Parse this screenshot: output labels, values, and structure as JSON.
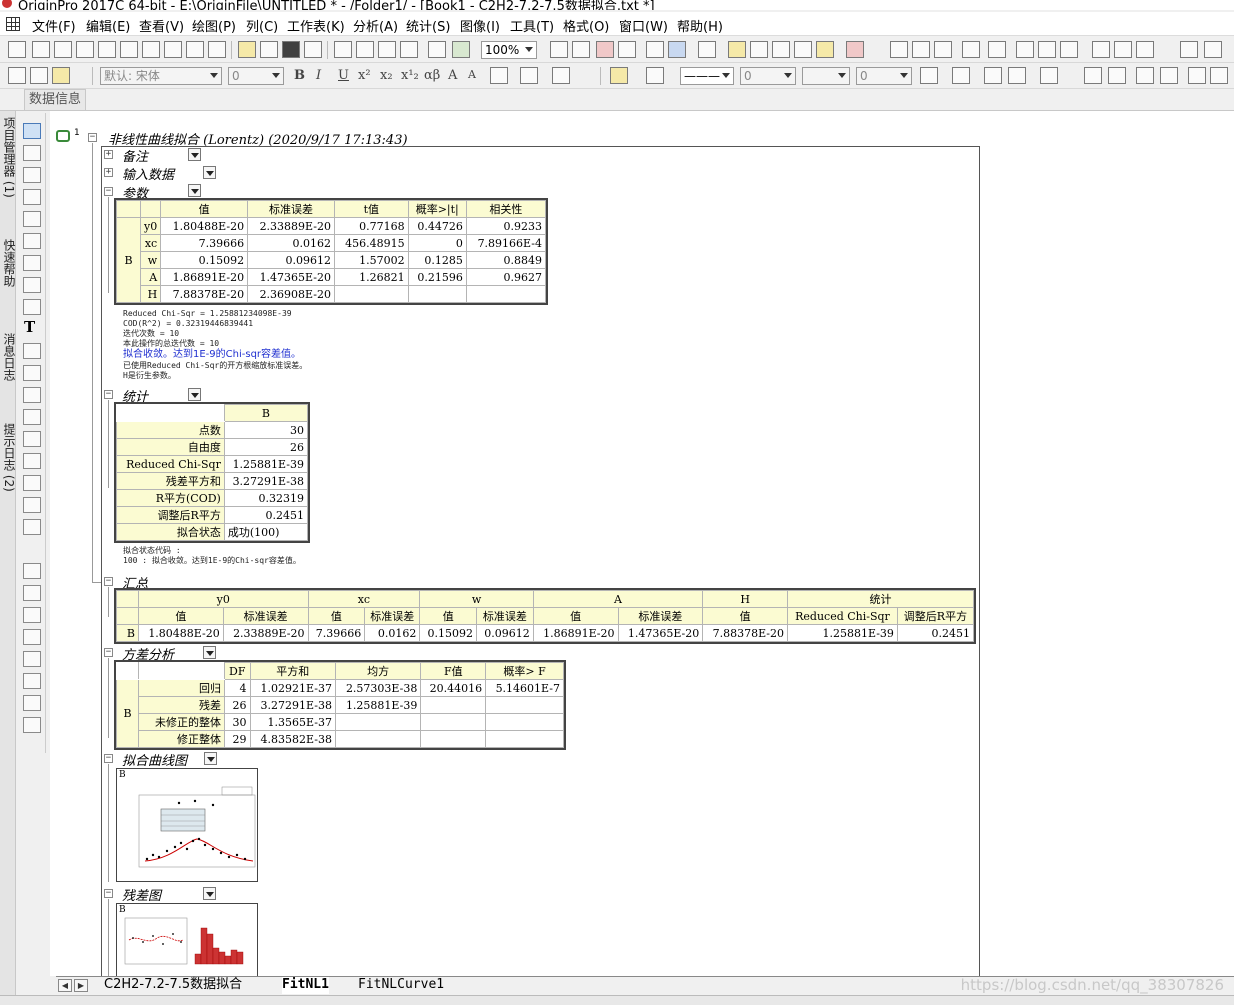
{
  "window": {
    "title": "OriginPro 2017C 64-bit - E:\\OriginFile\\UNTITLED * - /Folder1/ - [Book1 - C2H2-7.2-7.5数据拟合.txt *]"
  },
  "menu": [
    "文件(F)",
    "编辑(E)",
    "查看(V)",
    "绘图(P)",
    "列(C)",
    "工作表(K)",
    "分析(A)",
    "统计(S)",
    "图像(I)",
    "工具(T)",
    "格式(O)",
    "窗口(W)",
    "帮助(H)"
  ],
  "toolbar": {
    "zoom": "100%",
    "font": "默认: 宋体",
    "font_size": "0",
    "line_width": "0",
    "line_width2": "0",
    "styles": [
      "B",
      "I",
      "U",
      "x²",
      "x₂",
      "x¹₂",
      "αβ",
      "A",
      "A"
    ]
  },
  "data_info_tab": "数据信息",
  "left_dock_tabs": [
    "项目管理器 (1)",
    "快速帮助",
    "消息日志",
    "提示日志 (2)"
  ],
  "report": {
    "title": "非线性曲线拟合 (Lorentz) (2020/9/17 17:13:43)",
    "sections": {
      "notes": "备注",
      "input": "输入数据",
      "params": "参数",
      "stats": "统计",
      "summary": "汇总",
      "anova": "方差分析",
      "fitcurve": "拟合曲线图",
      "residual": "残差图"
    },
    "params_table": {
      "headers": [
        "值",
        "标准误差",
        "t值",
        "概率>|t|",
        "相关性"
      ],
      "group": "B",
      "rows": [
        {
          "name": "y0",
          "vals": [
            "1.80488E-20",
            "2.33889E-20",
            "0.77168",
            "0.44726",
            "0.9233"
          ]
        },
        {
          "name": "xc",
          "vals": [
            "7.39666",
            "0.0162",
            "456.48915",
            "0",
            "7.89166E-4"
          ]
        },
        {
          "name": "w",
          "vals": [
            "0.15092",
            "0.09612",
            "1.57002",
            "0.1285",
            "0.8849"
          ]
        },
        {
          "name": "A",
          "vals": [
            "1.86891E-20",
            "1.47365E-20",
            "1.26821",
            "0.21596",
            "0.9627"
          ]
        },
        {
          "name": "H",
          "vals": [
            "7.88378E-20",
            "2.36908E-20",
            "",
            "",
            ""
          ]
        }
      ]
    },
    "params_notes": [
      "Reduced Chi-Sqr = 1.25881234098E-39",
      "COD(R^2) = 0.32319446839441",
      "迭代次数 = 10",
      "本此操作的总迭代数 = 10",
      "拟合收敛。达到1E-9的Chi-sqr容差值。",
      "已使用Reduced Chi-Sqr的开方根缩放标准误差。",
      "H是衍生参数。"
    ],
    "stats_table": {
      "col": "B",
      "rows": [
        {
          "label": "点数",
          "value": "30"
        },
        {
          "label": "自由度",
          "value": "26"
        },
        {
          "label": "Reduced Chi-Sqr",
          "value": "1.25881E-39"
        },
        {
          "label": "残差平方和",
          "value": "3.27291E-38"
        },
        {
          "label": "R平方(COD)",
          "value": "0.32319"
        },
        {
          "label": "调整后R平方",
          "value": "0.2451"
        },
        {
          "label": "拟合状态",
          "value": "成功(100)"
        }
      ]
    },
    "stats_notes": [
      "拟合状态代码 :",
      "100 : 拟合收敛。达到1E-9的Chi-sqr容差值。"
    ],
    "summary_table": {
      "groups": [
        "y0",
        "xc",
        "w",
        "A",
        "H",
        "统计"
      ],
      "subheaders": [
        "值",
        "标准误差",
        "值",
        "标准误差",
        "值",
        "标准误差",
        "值",
        "标准误差",
        "值",
        "Reduced Chi-Sqr",
        "调整后R平方"
      ],
      "row_label": "B",
      "values": [
        "1.80488E-20",
        "2.33889E-20",
        "7.39666",
        "0.0162",
        "0.15092",
        "0.09612",
        "1.86891E-20",
        "1.47365E-20",
        "7.88378E-20",
        "1.25881E-39",
        "0.2451"
      ]
    },
    "anova_table": {
      "headers": [
        "DF",
        "平方和",
        "均方",
        "F值",
        "概率> F"
      ],
      "group": "B",
      "rows": [
        {
          "label": "回归",
          "vals": [
            "4",
            "1.02921E-37",
            "2.57303E-38",
            "20.44016",
            "5.14601E-7"
          ]
        },
        {
          "label": "残差",
          "vals": [
            "26",
            "3.27291E-38",
            "1.25881E-39",
            "",
            ""
          ]
        },
        {
          "label": "未修正的整体",
          "vals": [
            "30",
            "1.3565E-37",
            "",
            "",
            ""
          ]
        },
        {
          "label": "修正整体",
          "vals": [
            "29",
            "4.83582E-38",
            "",
            "",
            ""
          ]
        }
      ]
    },
    "fitcurve_label": "B",
    "residual_label": "B"
  },
  "sheet_tabs": [
    "C2H2-7.2-7.5数据拟合",
    "FitNL1",
    "FitNLCurve1"
  ],
  "active_sheet": "FitNL1",
  "watermark": "https://blog.csdn.net/qq_38307826"
}
